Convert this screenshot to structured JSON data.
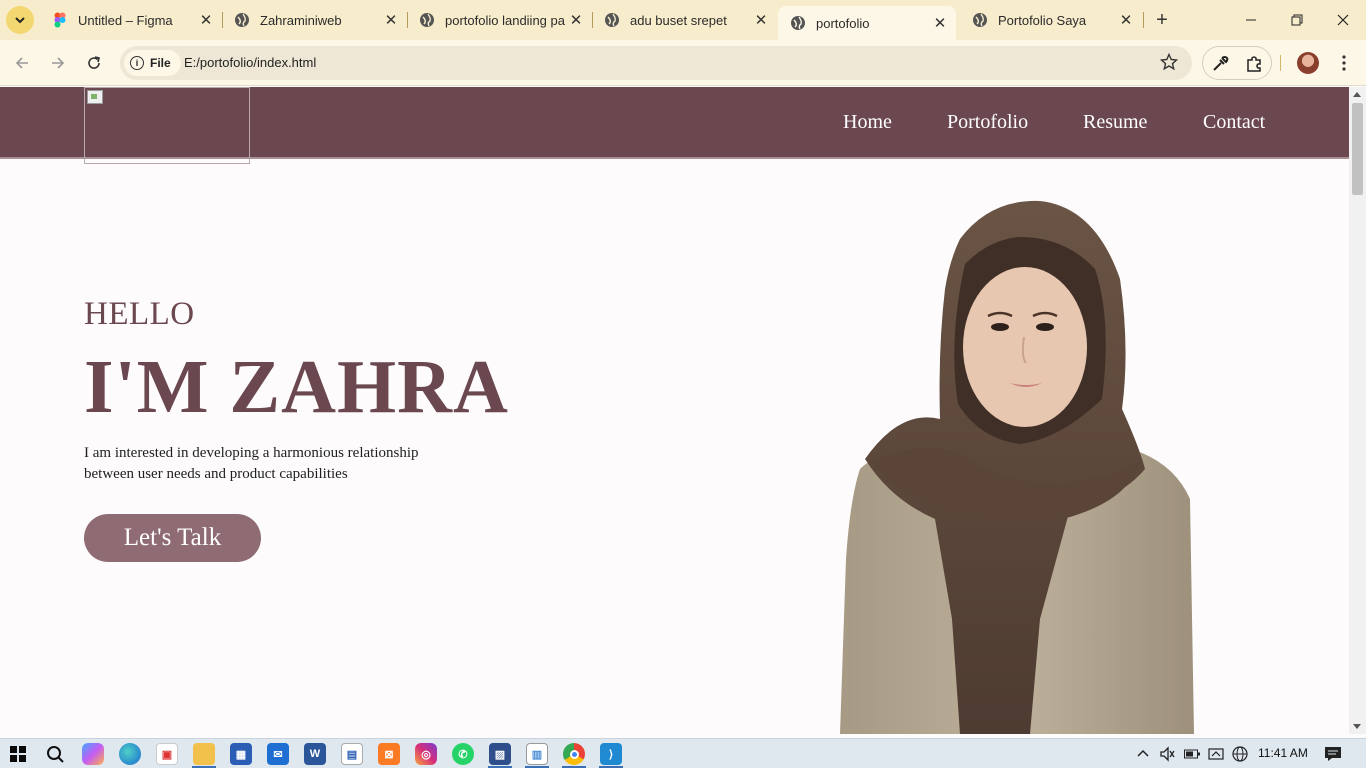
{
  "browser": {
    "tabs": [
      {
        "title": "Untitled – Figma",
        "icon": "figma-icon",
        "active": false
      },
      {
        "title": "Zahraminiweb",
        "icon": "globe-icon",
        "active": false
      },
      {
        "title": "portofolio landiing pa",
        "icon": "globe-icon",
        "active": false
      },
      {
        "title": "adu buset srepet",
        "icon": "globe-icon",
        "active": false
      },
      {
        "title": "portofolio",
        "icon": "globe-icon",
        "active": true
      },
      {
        "title": "Portofolio Saya",
        "icon": "globe-icon",
        "active": false
      }
    ],
    "close_glyph": "✕",
    "new_tab_glyph": "+",
    "address": {
      "chip_label": "File",
      "url": "E:/portofolio/index.html"
    },
    "accent": "#f3d871"
  },
  "page": {
    "nav": {
      "links": [
        "Home",
        "Portofolio",
        "Resume",
        "Contact"
      ],
      "background": "#6b4750"
    },
    "hero": {
      "greeting": "HELLO",
      "name": "I'M ZAHRA",
      "description": "I am interested in developing a harmonious relationship between user needs and product capabilities",
      "cta_label": "Let's Talk",
      "accent": "#6b4750",
      "button_color": "#8f6c74"
    }
  },
  "taskbar": {
    "apps": [
      "start-icon",
      "search-icon",
      "copilot-icon",
      "edge-icon",
      "gift-icon",
      "file-explorer-icon",
      "store-icon",
      "mail-icon",
      "word-icon",
      "news-icon",
      "xampp-icon",
      "instagram-icon",
      "whatsapp-icon",
      "photos-icon",
      "notepad-icon",
      "chrome-icon",
      "vscode-icon"
    ],
    "time": "11:41 AM"
  }
}
